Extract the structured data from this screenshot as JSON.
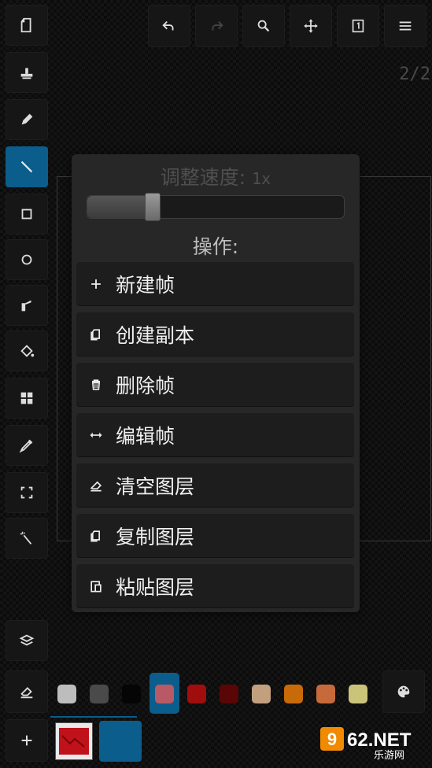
{
  "header": {
    "page_indicator": "2/2"
  },
  "dialog": {
    "speed_label": "调整速度:",
    "speed_value": "1x",
    "speed_slider_fraction": 0.25,
    "ops_title": "操作:",
    "actions": [
      {
        "label": "新建帧",
        "icon": "plus-icon"
      },
      {
        "label": "创建副本",
        "icon": "duplicate-icon"
      },
      {
        "label": "删除帧",
        "icon": "trash-icon"
      },
      {
        "label": "编辑帧",
        "icon": "move-horizontal-icon"
      },
      {
        "label": "清空图层",
        "icon": "eraser-icon"
      },
      {
        "label": "复制图层",
        "icon": "copy-icon"
      },
      {
        "label": "粘贴图层",
        "icon": "paste-icon"
      }
    ]
  },
  "palette": {
    "colors": [
      "#bdbdbd",
      "#4a4a4a",
      "#050505",
      "#b85a66",
      "#a10d0d",
      "#5a0606",
      "#c2a07e",
      "#c86a08",
      "#c66a3b",
      "#c9c47a"
    ],
    "selected_index": 3
  },
  "colors": {
    "accent": "#0b5d8c",
    "panel": "#272727",
    "button": "#1d1d1d"
  },
  "watermark": {
    "brand": "962.NET",
    "sub": "乐游网"
  }
}
